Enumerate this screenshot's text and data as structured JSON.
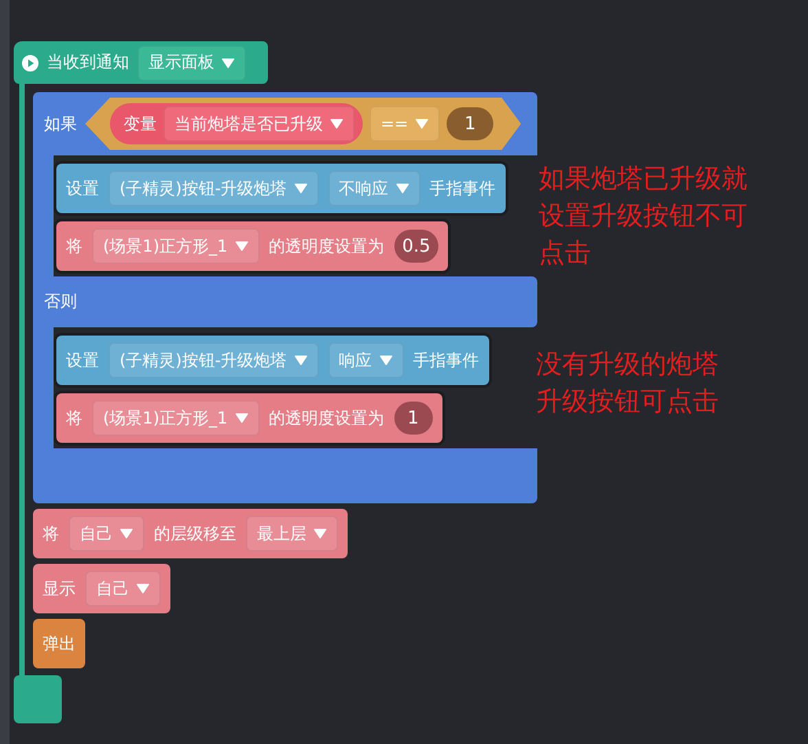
{
  "script": {
    "hat": {
      "label": "当收到通知",
      "dropdown": "显示面板"
    },
    "blocks": [
      {
        "kind": "if_else",
        "color": "#4f7fd8",
        "if_label": "如果",
        "condition": {
          "variable_label": "变量",
          "variable": "当前炮塔是否已升级",
          "operator": "==",
          "value": "1"
        },
        "then": [
          {
            "kind": "action",
            "color": "#5ba7cf",
            "outlined": true,
            "parts": [
              {
                "kind": "text",
                "text": "设置"
              },
              {
                "kind": "dropdown",
                "text": "(子精灵)按钮-升级炮塔"
              },
              {
                "kind": "dropdown",
                "text": "不响应"
              },
              {
                "kind": "text",
                "text": "手指事件"
              }
            ]
          },
          {
            "kind": "action",
            "color": "#e57d87",
            "outlined": true,
            "parts": [
              {
                "kind": "text",
                "text": "将"
              },
              {
                "kind": "dropdown",
                "text": "(场景1)正方形_1"
              },
              {
                "kind": "text",
                "text": "的透明度设置为"
              },
              {
                "kind": "number",
                "text": "0.5"
              }
            ]
          }
        ],
        "else_label": "否则",
        "else": [
          {
            "kind": "action",
            "color": "#5ba7cf",
            "outlined": true,
            "parts": [
              {
                "kind": "text",
                "text": "设置"
              },
              {
                "kind": "dropdown",
                "text": "(子精灵)按钮-升级炮塔"
              },
              {
                "kind": "dropdown",
                "text": "响应"
              },
              {
                "kind": "text",
                "text": "手指事件"
              }
            ]
          },
          {
            "kind": "action",
            "color": "#e57d87",
            "outlined": true,
            "parts": [
              {
                "kind": "text",
                "text": "将"
              },
              {
                "kind": "dropdown",
                "text": "(场景1)正方形_1"
              },
              {
                "kind": "text",
                "text": "的透明度设置为"
              },
              {
                "kind": "number",
                "text": "1"
              }
            ]
          }
        ]
      },
      {
        "kind": "action",
        "color": "#e57d87",
        "outlined": false,
        "parts": [
          {
            "kind": "text",
            "text": "将"
          },
          {
            "kind": "dropdown",
            "text": "自己"
          },
          {
            "kind": "text",
            "text": "的层级移至"
          },
          {
            "kind": "dropdown",
            "text": "最上层"
          }
        ]
      },
      {
        "kind": "action",
        "color": "#e57d87",
        "outlined": false,
        "parts": [
          {
            "kind": "text",
            "text": "显示"
          },
          {
            "kind": "dropdown",
            "text": "自己"
          }
        ]
      },
      {
        "kind": "action",
        "color": "#db8440",
        "outlined": false,
        "parts": [
          {
            "kind": "text",
            "text": "弹出"
          }
        ]
      }
    ]
  },
  "notes": [
    {
      "lines": [
        "如果炮塔已升级就",
        "设置升级按钮不可",
        "点击"
      ]
    },
    {
      "lines": [
        "没有升级的炮塔",
        "升级按钮可点击"
      ]
    }
  ]
}
